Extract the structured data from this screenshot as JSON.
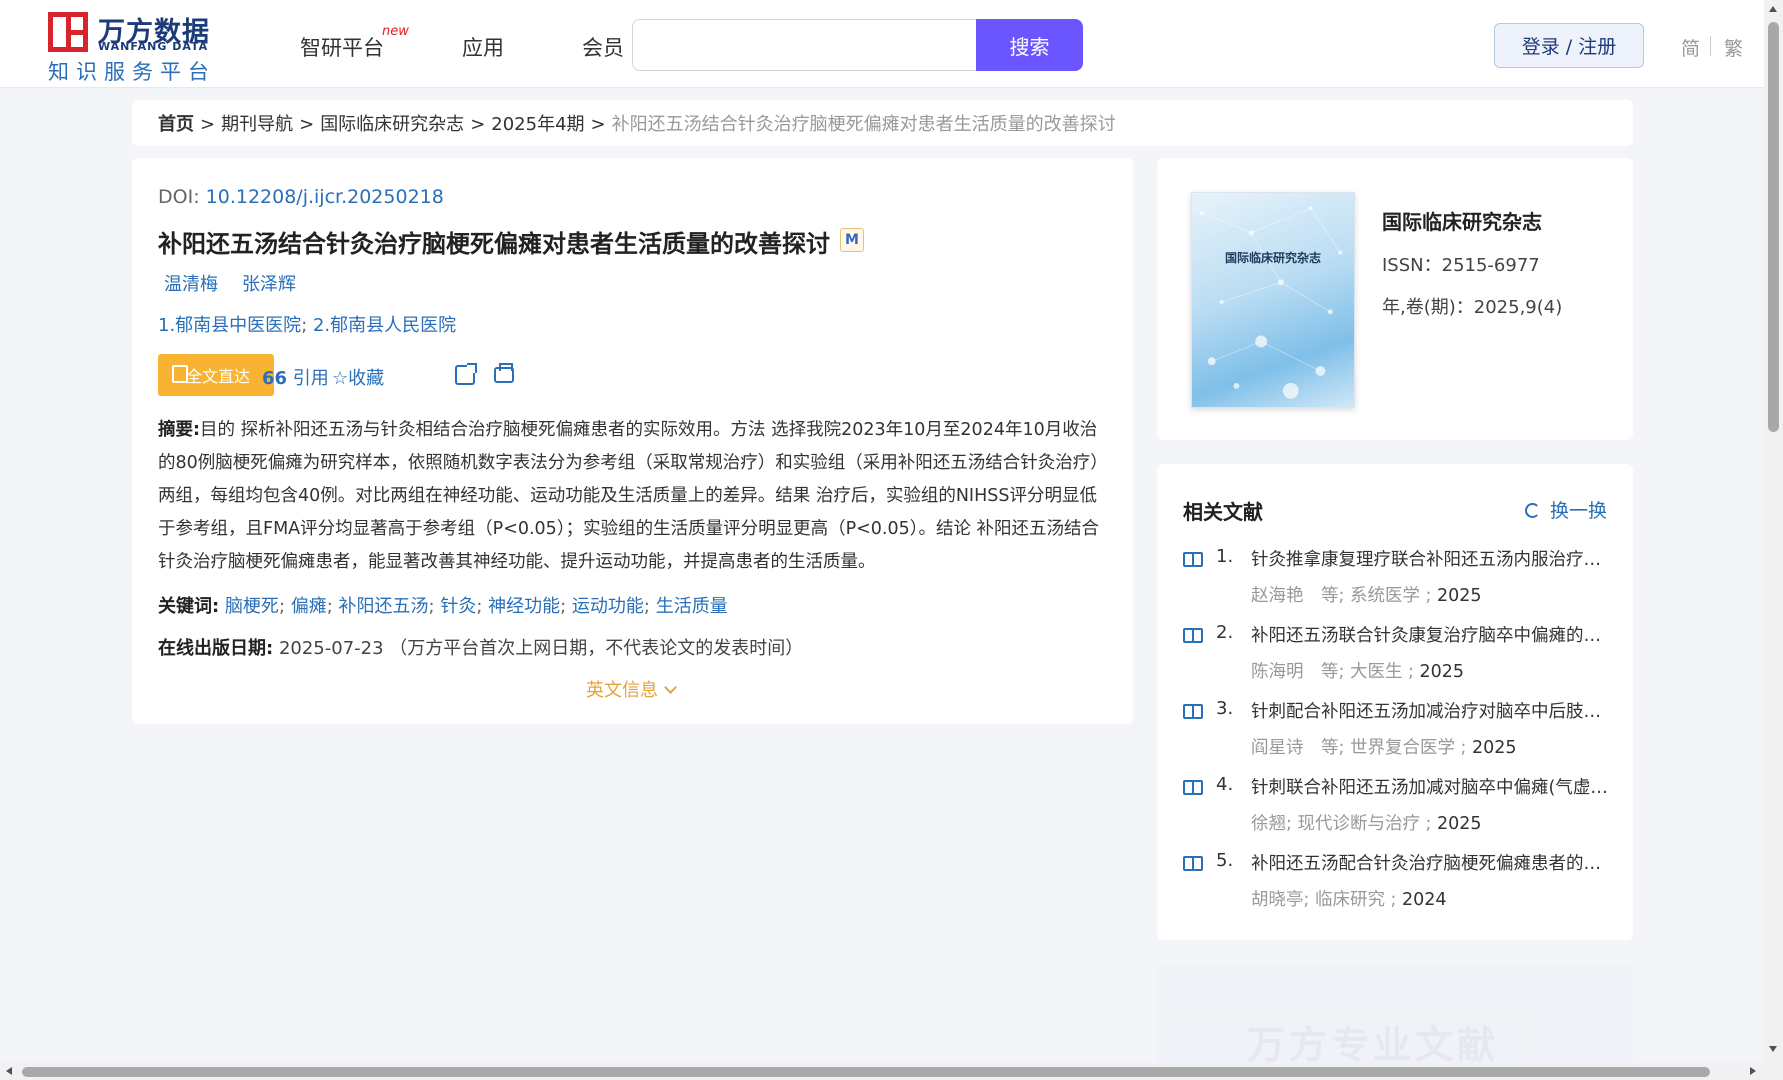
{
  "header": {
    "logo_cn": "万方数据",
    "logo_en": "WANFANG DATA",
    "logo_sub": "知识服务平台",
    "nav": [
      {
        "label": "智研平台",
        "badge": "new"
      },
      {
        "label": "应用"
      },
      {
        "label": "会员"
      }
    ],
    "search": {
      "value": "",
      "placeholder": "",
      "button_label": "搜索"
    },
    "login_label": "登录 / 注册",
    "lang_simplified": "简",
    "lang_traditional": "繁"
  },
  "breadcrumb": {
    "home": "首页",
    "items": [
      "期刊导航",
      "国际临床研究杂志",
      "2025年4期"
    ],
    "current": "补阳还五汤结合针灸治疗脑梗死偏瘫对患者生活质量的改善探讨",
    "separator": ">"
  },
  "article": {
    "doi_label": "DOI:",
    "doi": "10.12208/j.ijcr.20250218",
    "title": "补阳还五汤结合针灸治疗脑梗死偏瘫对患者生活质量的改善探讨",
    "badge": "M",
    "authors": [
      "温清梅",
      "张泽辉"
    ],
    "affiliations": [
      "1.郁南县中医医院",
      "2.郁南县人民医院"
    ],
    "actions": {
      "fulltext": "全文直达",
      "cite": "引用",
      "favorite": "收藏"
    },
    "abstract_label": "摘要:",
    "abstract": "目的 探析补阳还五汤与针灸相结合治疗脑梗死偏瘫患者的实际效用。方法 选择我院2023年10月至2024年10月收治的80例脑梗死偏瘫为研究样本，依照随机数字表法分为参考组（采取常规治疗）和实验组（采用补阳还五汤结合针灸治疗）两组，每组均包含40例。对比两组在神经功能、运动功能及生活质量上的差异。结果 治疗后，实验组的NIHSS评分明显低于参考组，且FMA评分均显著高于参考组（P<0.05）；实验组的生活质量评分明显更高（P<0.05）。结论 补阳还五汤结合针灸治疗脑梗死偏瘫患者，能显著改善其神经功能、提升运动功能，并提高患者的生活质量。",
    "keywords_label": "关键词:",
    "keywords": [
      "脑梗死",
      "偏瘫",
      "补阳还五汤",
      "针灸",
      "神经功能",
      "运动功能",
      "生活质量"
    ],
    "pubdate_label": "在线出版日期:",
    "pubdate": "2025-07-23",
    "pubdate_note": "（万方平台首次上网日期，不代表论文的发表时间）",
    "en_info": "英文信息"
  },
  "journal": {
    "cover_title": "国际临床研究杂志",
    "name": "国际临床研究杂志",
    "issn": "ISSN：2515-6977",
    "volume": "年,卷(期)：2025,9(4)"
  },
  "related": {
    "title": "相关文献",
    "refresh_label": "换一换",
    "items": [
      {
        "num": "1.",
        "title": "针灸推拿康复理疗联合补阳还五汤内服治疗脑梗死偏瘫的效果",
        "meta": "赵海艳　等;  系统医学 ;",
        "year": "2025"
      },
      {
        "num": "2.",
        "title": "补阳还五汤联合针灸康复治疗脑卒中偏瘫的临床效果",
        "meta": "陈海明　等;  大医生 ;",
        "year": "2025"
      },
      {
        "num": "3.",
        "title": "针刺配合补阳还五汤加减治疗对脑卒中后肢体功能障碍的影响",
        "meta": "阎星诗　等;  世界复合医学 ;",
        "year": "2025"
      },
      {
        "num": "4.",
        "title": "针刺联合补阳还五汤加减对脑卒中偏瘫(气虚血瘀证)的疗效",
        "meta": "徐翘; 现代诊断与治疗 ;",
        "year": "2025"
      },
      {
        "num": "5.",
        "title": "补阳还五汤配合针灸治疗脑梗死偏瘫患者的临床效果",
        "meta": "胡晓亭; 临床研究 ;",
        "year": "2024"
      }
    ]
  },
  "promo": {
    "text": "万方专业文献"
  }
}
